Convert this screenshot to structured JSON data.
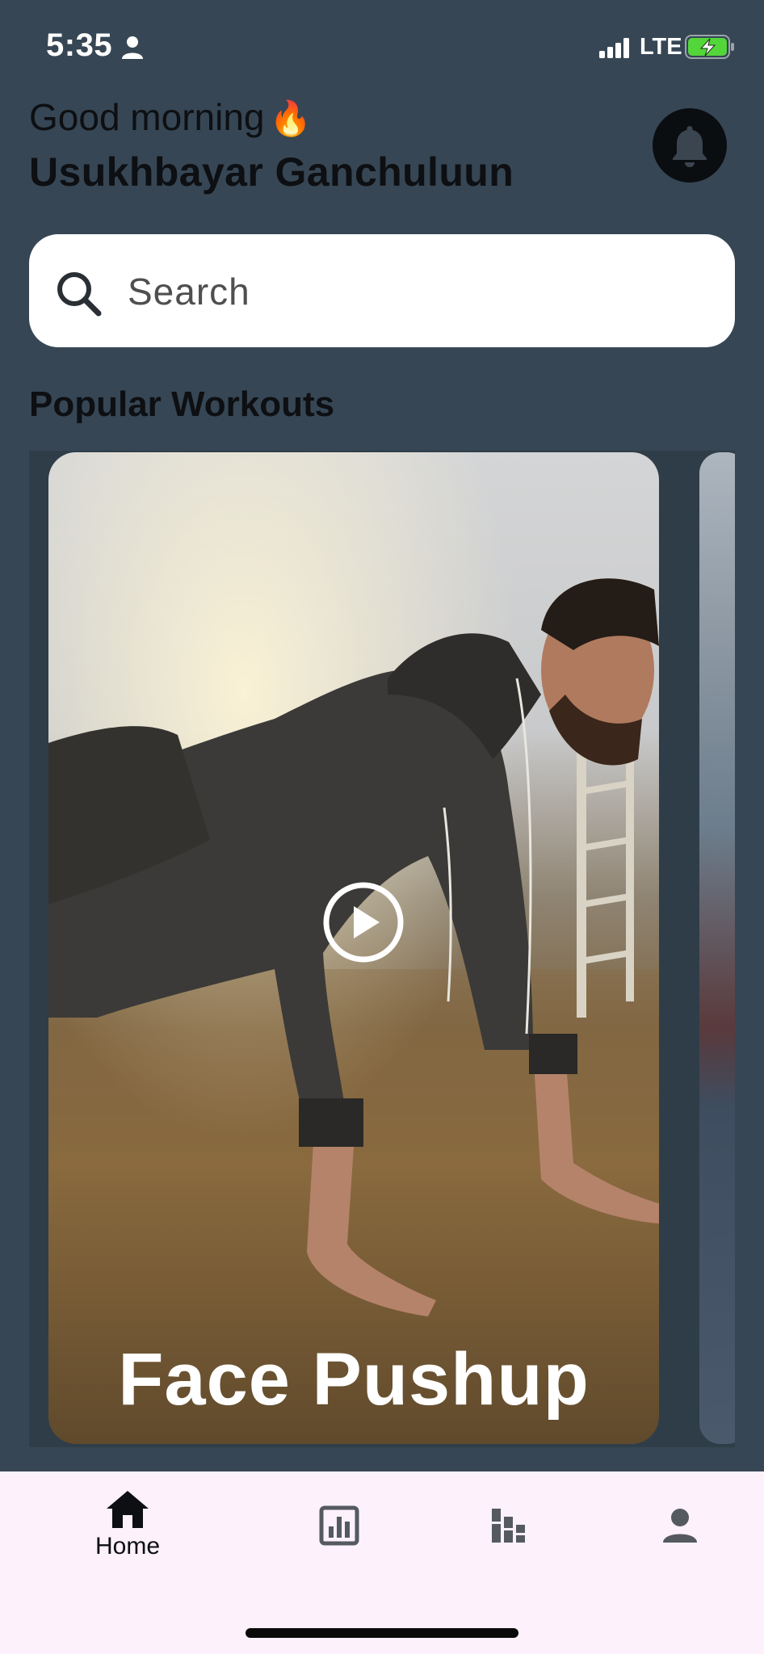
{
  "status_bar": {
    "time": "5:35",
    "network": "LTE",
    "icons": [
      "person-icon",
      "signal-icon",
      "battery-charging-icon"
    ]
  },
  "header": {
    "greeting": "Good morning",
    "greeting_emoji": "🔥",
    "user_name": "Usukhbayar Ganchuluun",
    "bell_icon": "bell-icon"
  },
  "search": {
    "placeholder": "Search",
    "icon": "search-icon"
  },
  "popular": {
    "title": "Popular Workouts",
    "cards": [
      {
        "title": "Face Pushup",
        "icon": "play-icon"
      }
    ]
  },
  "nav": {
    "items": [
      {
        "label": "Home",
        "icon": "home-icon",
        "active": true
      },
      {
        "label": "",
        "icon": "stats-icon",
        "active": false
      },
      {
        "label": "",
        "icon": "leaderboard-icon",
        "active": false
      },
      {
        "label": "",
        "icon": "profile-icon",
        "active": false
      }
    ]
  },
  "colors": {
    "background": "#364654",
    "card_surface": "#ffffff",
    "nav_background": "#fdf1fb",
    "text_dark": "#0d0f12"
  }
}
